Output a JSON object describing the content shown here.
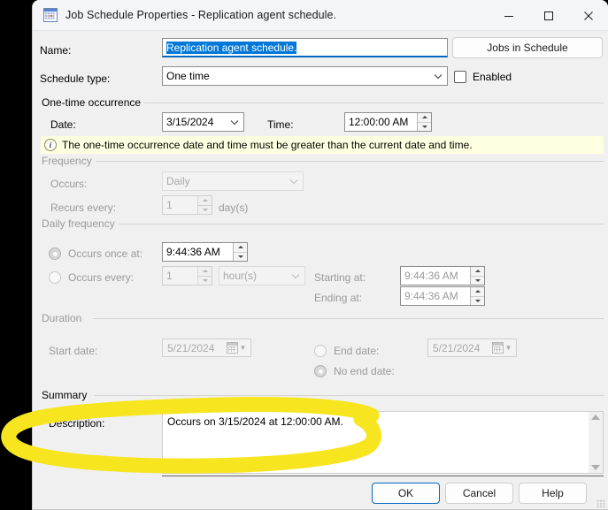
{
  "window": {
    "title": "Job Schedule Properties - Replication agent schedule.",
    "icon": "calendar-grid-icon",
    "controls": {
      "minimize": "minimize-icon",
      "maximize": "maximize-icon",
      "close": "close-icon"
    }
  },
  "form": {
    "name_label": "Name:",
    "name_value": "Replication agent schedule.",
    "jobs_in_schedule_button": "Jobs in Schedule",
    "schedule_type_label": "Schedule type:",
    "schedule_type_value": "One time",
    "enabled_label": "Enabled",
    "enabled_checked": false
  },
  "one_time": {
    "group_label": "One-time occurrence",
    "date_label": "Date:",
    "date_value": "3/15/2024",
    "time_label": "Time:",
    "time_value": "12:00:00 AM",
    "info_message": "The one-time occurrence date and time must be greater than the current date and time.",
    "info_icon": "info-icon"
  },
  "frequency": {
    "group_label": "Frequency",
    "occurs_label": "Occurs:",
    "occurs_value": "Daily",
    "recurs_every_label": "Recurs every:",
    "recurs_every_value": "1",
    "recurs_units": "day(s)"
  },
  "daily_frequency": {
    "group_label": "Daily frequency",
    "occurs_once_label": "Occurs once at:",
    "occurs_once_value": "9:44:36 AM",
    "occurs_once_selected": true,
    "occurs_every_label": "Occurs every:",
    "occurs_every_value": "1",
    "occurs_every_units": "hour(s)",
    "occurs_every_selected": false,
    "starting_at_label": "Starting at:",
    "starting_at_value": "9:44:36 AM",
    "ending_at_label": "Ending at:",
    "ending_at_value": "9:44:36 AM"
  },
  "duration": {
    "group_label": "Duration",
    "start_date_label": "Start date:",
    "start_date_value": "5/21/2024",
    "end_date_label": "End date:",
    "end_date_value": "5/21/2024",
    "end_date_selected": false,
    "no_end_date_label": "No end date:",
    "no_end_date_selected": true
  },
  "summary": {
    "group_label": "Summary",
    "description_label": "Description:",
    "description_value": "Occurs on 3/15/2024 at 12:00:00 AM."
  },
  "buttons": {
    "ok": "OK",
    "cancel": "Cancel",
    "help": "Help"
  },
  "annotation": {
    "type": "hand-drawn-ellipse-highlight",
    "color": "#f7e520"
  }
}
